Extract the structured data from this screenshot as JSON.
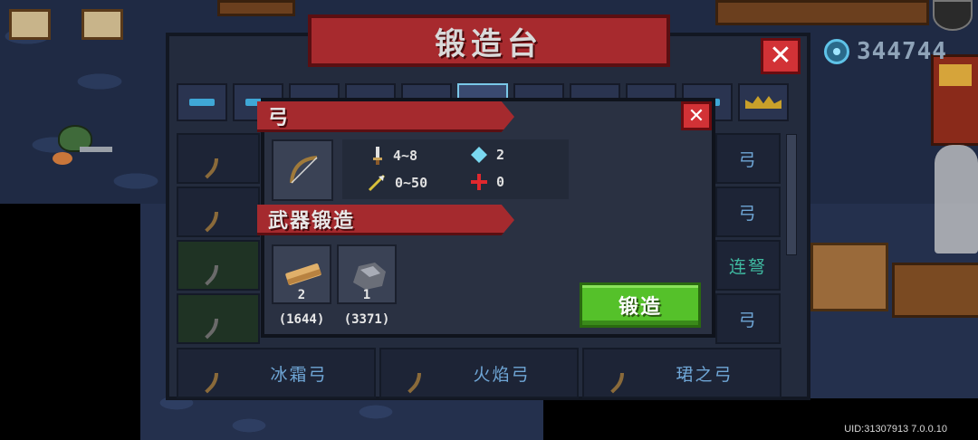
{
  "panel": {
    "title": "锻造台",
    "close_icon": "close-icon"
  },
  "currency": {
    "gems": "344744",
    "icon": "gem-icon"
  },
  "tabs": [
    {
      "icon": "pistol-icon",
      "active": false
    },
    {
      "icon": "rifle-icon",
      "active": false
    },
    {
      "icon": "shotgun-icon",
      "active": false
    },
    {
      "icon": "laser-icon",
      "active": false
    },
    {
      "icon": "staff-icon",
      "active": false
    },
    {
      "icon": "bow-icon",
      "active": true
    },
    {
      "icon": "melee-icon",
      "active": false
    },
    {
      "icon": "throw-icon",
      "active": false
    },
    {
      "icon": "fish-icon",
      "active": false
    },
    {
      "icon": "special-icon",
      "active": false
    },
    {
      "icon": "crown-icon",
      "active": false
    }
  ],
  "weapon_list": {
    "right_column_fragments": [
      "弓",
      "弓",
      "连弩",
      "弓"
    ],
    "bottom_row": [
      {
        "name": "冰霜弓"
      },
      {
        "name": "火焰弓"
      },
      {
        "name": "珺之弓"
      }
    ]
  },
  "detail": {
    "name": "弓",
    "close_icon": "close-icon",
    "stats": {
      "damage": "4~8",
      "energy": "2",
      "accuracy": "0~50",
      "critical": "0"
    },
    "forge_section_title": "武器锻造",
    "materials": [
      {
        "icon": "wood-icon",
        "required": "2",
        "owned": "(1644)"
      },
      {
        "icon": "iron-ore-icon",
        "required": "1",
        "owned": "(3371)"
      }
    ],
    "forge_button": "锻造"
  },
  "uid_text": "UID:31307913 7.0.0.10",
  "colors": {
    "banner_red": "#a72a2e",
    "close_red": "#d23236",
    "forge_green": "#55c12a",
    "accent_blue": "#3fa7d6"
  }
}
